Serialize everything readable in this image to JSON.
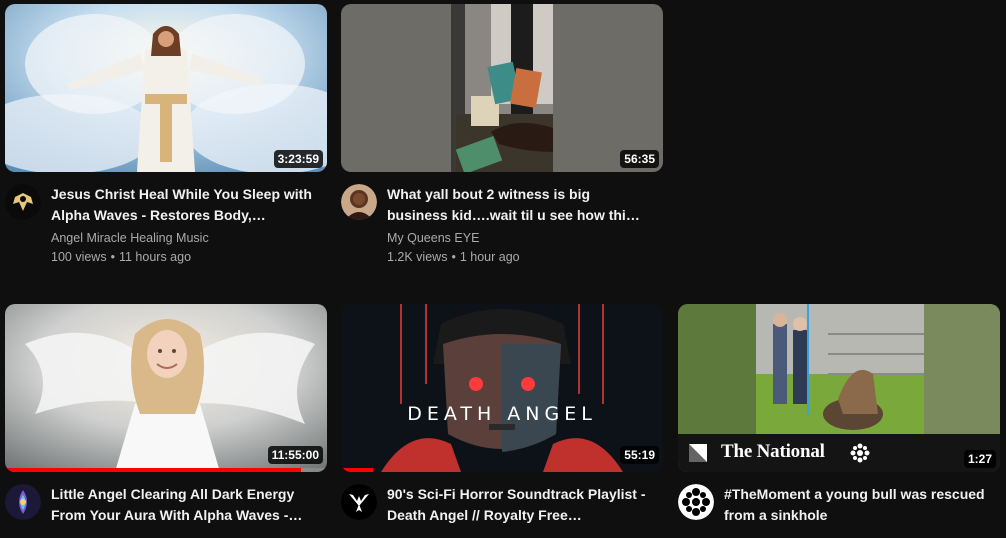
{
  "videos": [
    {
      "title": "Jesus Christ Heal While You Sleep with Alpha Waves - Restores Body,…",
      "channel": "Angel Miracle Healing Music",
      "views": "100 views",
      "age": "11 hours ago",
      "duration": "3:23:59"
    },
    {
      "title": "What yall bout 2 witness is big business kid….wait til u see how thi…",
      "channel": "My Queens EYE",
      "views": "1.2K views",
      "age": "1 hour ago",
      "duration": "56:35"
    },
    {
      "title": "Little Angel Clearing All Dark Energy From Your Aura With Alpha Waves -…",
      "duration": "11:55:00",
      "watch_progress": 0.92
    },
    {
      "title": "90's Sci-Fi Horror Soundtrack Playlist - Death Angel // Royalty Free…",
      "duration": "55:19",
      "thumbnail_text": "DEATH ANGEL",
      "watch_progress": 0.1
    },
    {
      "title": "#TheMoment a young bull was rescued from a sinkhole",
      "duration": "1:27",
      "thumbnail_brand": "The National"
    }
  ],
  "stats_separator": "•",
  "colors": {
    "background": "#0f0f0f",
    "progress": "#ff0000",
    "secondary_text": "#aaaaaa"
  }
}
